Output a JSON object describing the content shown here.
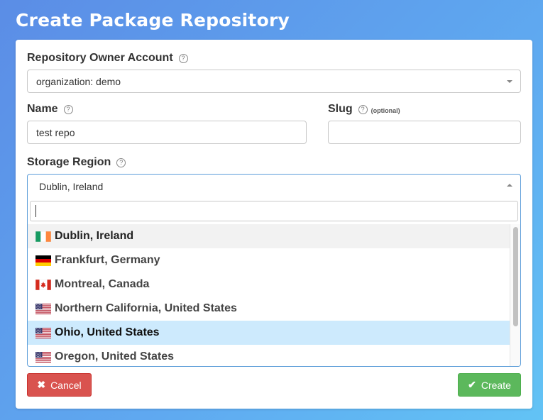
{
  "page": {
    "title": "Create Package Repository"
  },
  "owner": {
    "label": "Repository Owner Account",
    "help": "?",
    "value": "organization: demo"
  },
  "name": {
    "label": "Name",
    "help": "?",
    "value": "test repo"
  },
  "slug": {
    "label": "Slug",
    "help": "?",
    "optional": "(optional)",
    "value": ""
  },
  "region": {
    "label": "Storage Region",
    "help": "?",
    "value": "Dublin, Ireland",
    "search_value": "",
    "options": [
      {
        "label": "Dublin, Ireland",
        "flag": "ireland-flag-icon",
        "state": "selected"
      },
      {
        "label": "Frankfurt, Germany",
        "flag": "germany-flag-icon",
        "state": "normal"
      },
      {
        "label": "Montreal, Canada",
        "flag": "canada-flag-icon",
        "state": "normal"
      },
      {
        "label": "Northern California, United States",
        "flag": "us-flag-icon",
        "state": "normal"
      },
      {
        "label": "Ohio, United States",
        "flag": "us-flag-icon",
        "state": "hover"
      },
      {
        "label": "Oregon, United States",
        "flag": "us-flag-icon",
        "state": "normal"
      }
    ]
  },
  "buttons": {
    "cancel_icon": "✖",
    "cancel": "Cancel",
    "create_icon": "✔",
    "create": "Create"
  },
  "colors": {
    "cancel": "#d9534f",
    "create": "#5cb85c",
    "option_hover": "#cdeafd",
    "focus_border": "#5b9dd9"
  }
}
